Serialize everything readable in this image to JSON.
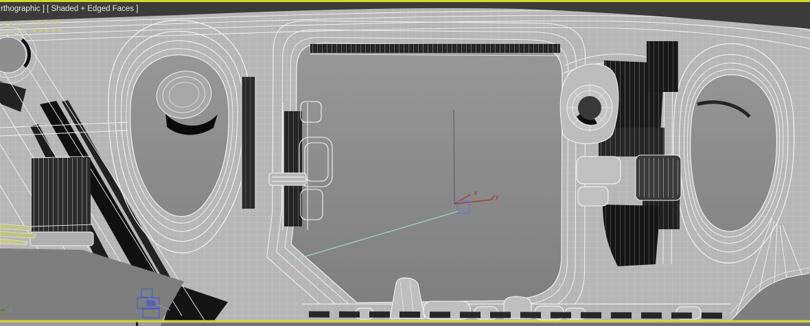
{
  "viewport": {
    "label_text": "rthographic ] [ Shaded + Edged Faces ]",
    "border_color": "#d8d62a",
    "bg_top": "#9c9c9c",
    "bg_bottom": "#7d7d7d",
    "mesh_fill": "#b6b6b6",
    "wire_color": "#f4f4f4",
    "dark_shade_color": "#161616",
    "top_band_color": "#3b3b3b"
  },
  "axis_gizmo": {
    "x_label": "x",
    "y_label": "y",
    "axis_color": "#a8322a",
    "selection_box_color": "#5a76e8",
    "tape_line_color": "#9fd6d4"
  },
  "world_axis": {
    "y_label": "y",
    "x_axis_color": "#3fa03f"
  },
  "helper_object": {
    "color": "#4659c8"
  },
  "stats_overlay": {
    "color": "#d2d37a"
  },
  "khaki_object": {
    "color": "#c3c68c"
  },
  "timeslider": {
    "tick_color": "#1a1a1a"
  }
}
